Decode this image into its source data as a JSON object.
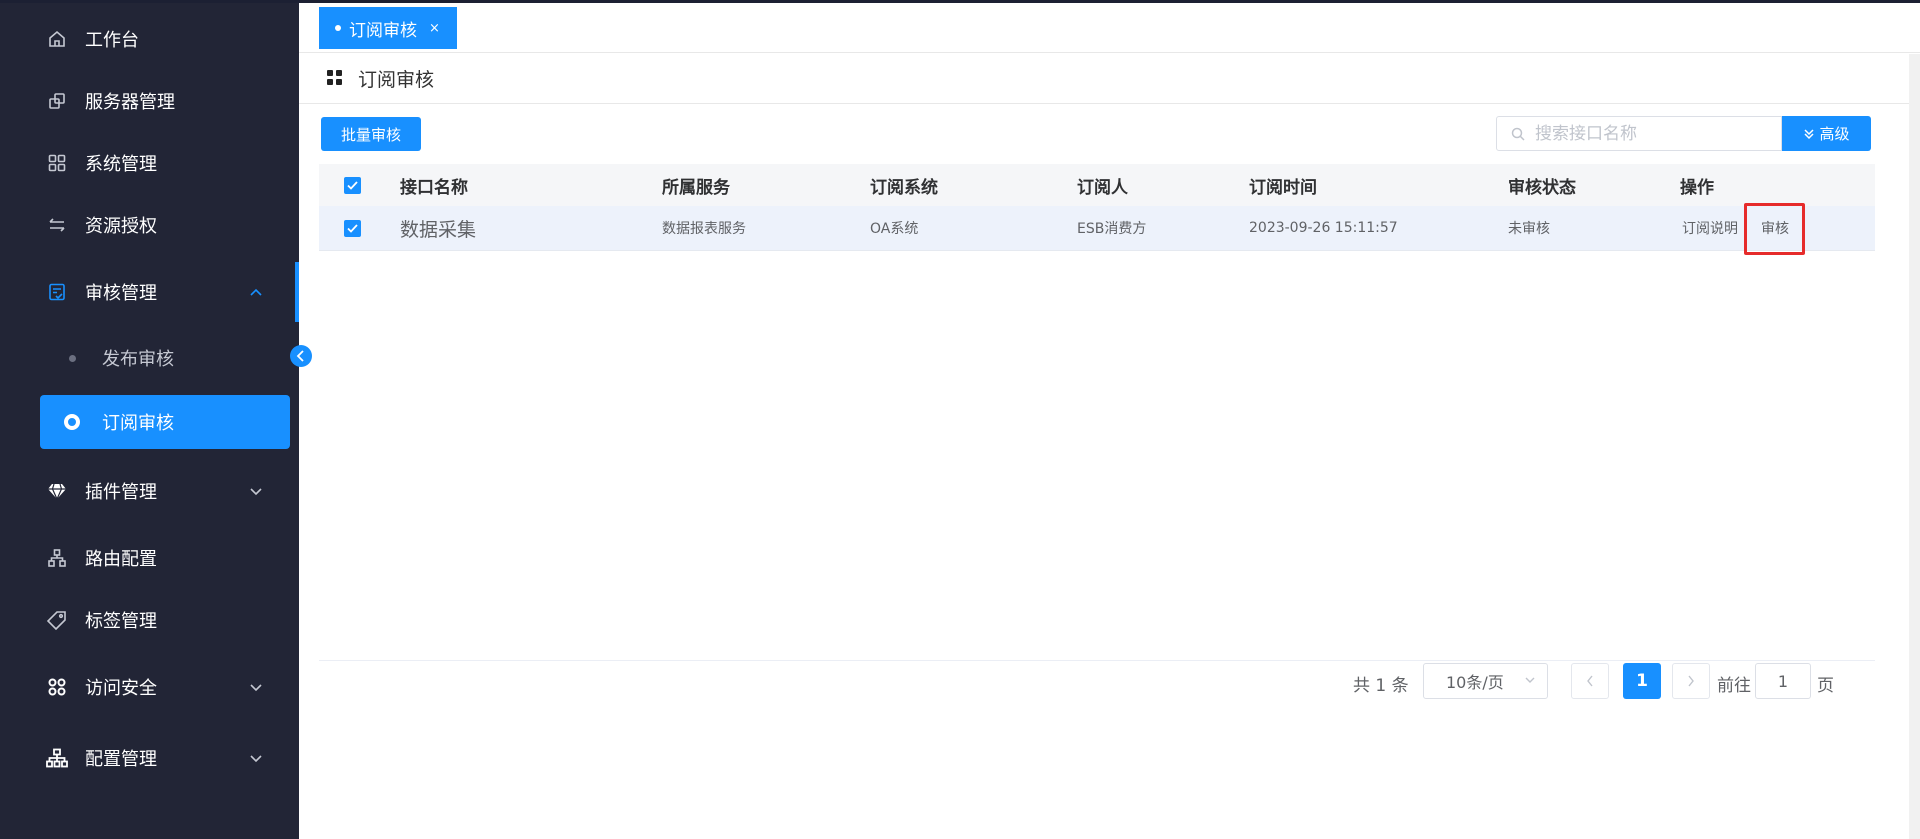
{
  "sidebar": {
    "items": [
      {
        "label": "工作台",
        "icon": "home-icon"
      },
      {
        "label": "服务器管理",
        "icon": "server-icon"
      },
      {
        "label": "系统管理",
        "icon": "grid-icon"
      },
      {
        "label": "资源授权",
        "icon": "arrows-icon"
      },
      {
        "label": "审核管理",
        "icon": "audit-icon",
        "expanded": true
      },
      {
        "label": "插件管理",
        "icon": "diamond-icon"
      },
      {
        "label": "路由配置",
        "icon": "sitemap-icon"
      },
      {
        "label": "标签管理",
        "icon": "tag-icon"
      },
      {
        "label": "访问安全",
        "icon": "apps-icon"
      },
      {
        "label": "配置管理",
        "icon": "org-icon"
      }
    ],
    "sub_items": [
      {
        "label": "发布审核"
      },
      {
        "label": "订阅审核",
        "selected": true
      }
    ]
  },
  "tabs": [
    {
      "label": "订阅审核",
      "close": "×"
    }
  ],
  "page": {
    "title": "订阅审核"
  },
  "toolbar": {
    "batch_label": "批量审核",
    "search_placeholder": "搜索接口名称",
    "advanced_label": "高级"
  },
  "table": {
    "headers": [
      "接口名称",
      "所属服务",
      "订阅系统",
      "订阅人",
      "订阅时间",
      "审核状态",
      "操作"
    ],
    "rows": [
      {
        "name": "数据采集",
        "service": "数据报表服务",
        "system": "OA系统",
        "subscriber": "ESB消费方",
        "time": "2023-09-26 15:11:57",
        "status": "未审核",
        "actions": [
          "订阅说明",
          "审核"
        ]
      }
    ]
  },
  "pagination": {
    "total": "共 1 条",
    "page_size": "10条/页",
    "current_page": "1",
    "goto_label": "前往",
    "goto_value": "1",
    "page_suffix": "页"
  },
  "colors": {
    "primary": "#1890ff",
    "sidebar_bg": "#222536",
    "highlight": "#e62b2b"
  }
}
